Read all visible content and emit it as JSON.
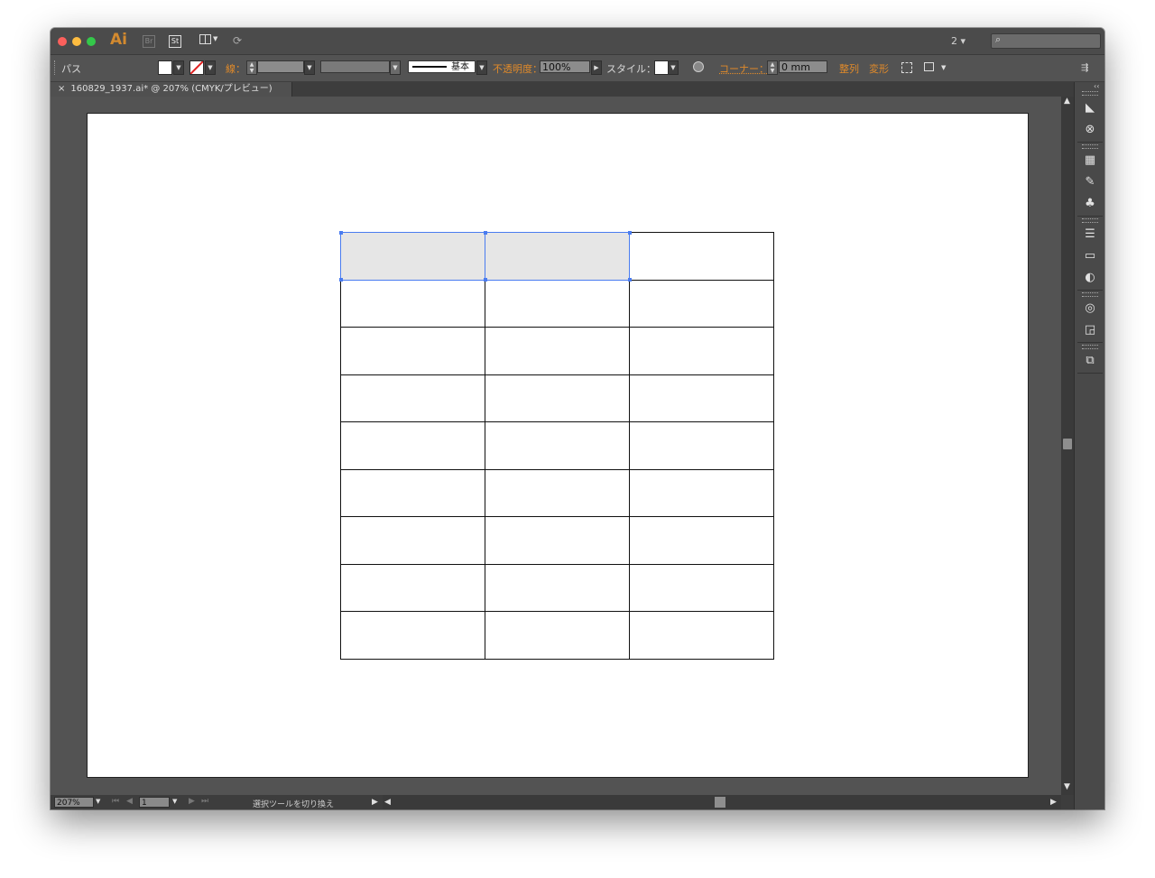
{
  "colors": {
    "window_bg": "#535353",
    "titlebar_bg": "#4b4b4b",
    "accent_orange": "#e08a2a",
    "selection_blue": "#4a7cf0",
    "selected_fill": "#e6e6e6",
    "close_red": "#fc605c",
    "minimize_yellow": "#fdbc40",
    "zoom_green": "#34c84a"
  },
  "titlebar": {
    "app_logo": "Ai",
    "bridge_label": "Br",
    "stock_label": "St",
    "workspace": "2"
  },
  "control_bar": {
    "object_type": "パス",
    "stroke_label": "線：",
    "stroke_profile": "基本",
    "opacity_label": "不透明度：",
    "opacity_value": "100%",
    "style_label": "スタイル：",
    "corner_label": "コーナー：",
    "corner_value": "0 mm",
    "align_label": "整列",
    "transform_label": "変形"
  },
  "document": {
    "tab_label": "160829_1937.ai* @ 207% (CMYK/プレビュー)"
  },
  "table": {
    "rows": 9,
    "cols": 3,
    "selected_cells": [
      [
        0,
        0
      ],
      [
        0,
        1
      ]
    ]
  },
  "status": {
    "zoom": "207%",
    "page": "1",
    "tool_hint": "選択ツールを切り換え"
  },
  "right_panel_icons": [
    "color-guide-icon",
    "symbol-sprayer-icon",
    "swatches-icon",
    "brushes-icon",
    "symbols-icon",
    "stroke-icon",
    "gradient-icon",
    "transparency-icon",
    "appearance-icon",
    "graphic-styles-icon",
    "layers-icon"
  ]
}
